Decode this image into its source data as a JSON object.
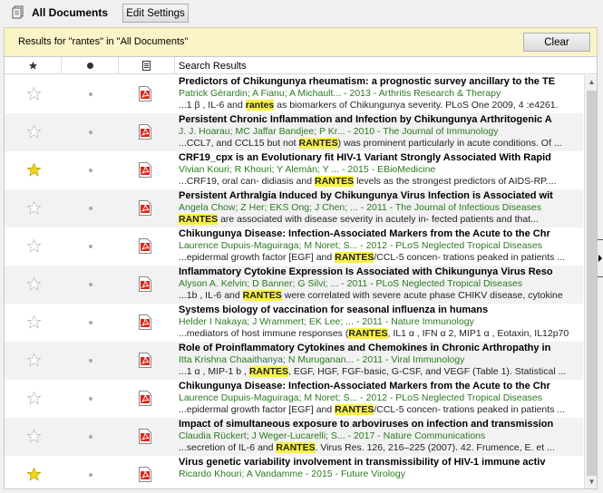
{
  "header": {
    "title": "All Documents",
    "edit_settings_label": "Edit Settings"
  },
  "search": {
    "results_label": "Results for \"rantes\" in \"All Documents\"",
    "clear_label": "Clear"
  },
  "table": {
    "columns": {
      "starred_icon": "star-icon",
      "read_icon": "dot-icon",
      "file_icon": "document-icon",
      "results_label": "Search Results"
    }
  },
  "colors": {
    "highlight": "#f7f148",
    "author": "#2a7a1f",
    "star_gold": "#f2d61c",
    "pdf_red": "#d8271c"
  },
  "results": [
    {
      "starred": false,
      "title": "Predictors of Chikungunya rheumatism: a prognostic survey ancillary to the TE",
      "authors": "Patrick Gérardin; A Fianu; A Michault... - 2013 - Arthritis Research & Therapy",
      "snippet_pre": "...1 β , IL-6 and ",
      "snippet_hl": "rantes",
      "snippet_post": " as biomarkers of Chikungunya severity. PLoS One 2009, 4 :e4261."
    },
    {
      "starred": false,
      "title": "Persistent Chronic Inflammation and Infection by Chikungunya Arthritogenic A",
      "authors": "J. J. Hoarau; MC Jaffar Bandjee; P Kr... - 2010 - The Journal of Immunology",
      "snippet_pre": "...CCL7, and CCL15 but not ",
      "snippet_hl": "RANTES",
      "snippet_post": ") was prominent particularly in acute conditions. Of ..."
    },
    {
      "starred": true,
      "title": "CRF19_cpx is an Evolutionary fit HIV-1 Variant Strongly Associated With Rapid",
      "authors": "Vivian Kouri; R Khouri; Y Alemán; Y ... - 2015 - EBioMedicine",
      "snippet_pre": "...CRF19, oral can- didiasis and ",
      "snippet_hl": "RANTES",
      "snippet_post": " levels as the strongest predictors of AIDS-RP...."
    },
    {
      "starred": false,
      "title": "Persistent Arthralgia Induced by Chikungunya Virus Infection is Associated wit",
      "authors": "Angela Chow; Z Her; EKS Ong; J Chen; ... - 2011 - The Journal of Infectious Diseases",
      "snippet_pre": "",
      "snippet_hl": "RANTES",
      "snippet_post": " are associated with disease severity in acutely in- fected patients and that..."
    },
    {
      "starred": false,
      "title": "Chikungunya Disease: Infection-Associated Markers from the Acute to the Chr",
      "authors": "Laurence Dupuis-Maguiraga; M Noret; S... - 2012 - PLoS Neglected Tropical Diseases",
      "snippet_pre": "...epidermal growth factor [EGF] and ",
      "snippet_hl": "RANTES",
      "snippet_post": "/CCL-5 concen- trations peaked in patients ..."
    },
    {
      "starred": false,
      "title": "Inflammatory Cytokine Expression Is Associated with Chikungunya Virus Reso",
      "authors": "Alyson A. Kelvin; D Banner; G Silvi; ... - 2011 - PLoS Neglected Tropical Diseases",
      "snippet_pre": "...1b , IL-6 and ",
      "snippet_hl": "RANTES",
      "snippet_post": " were correlated with severe acute phase CHIKV disease, cytokine"
    },
    {
      "starred": false,
      "title": "Systems biology of vaccination for seasonal influenza in humans",
      "authors": "Helder I Nakaya; J Wrammert; EK Lee; ... - 2011 - Nature Immunology",
      "snippet_pre": "...mediators of host immune responses (",
      "snippet_hl": "RANTES",
      "snippet_post": ", IL1 α , IFN α 2, MIP1 α , Eotaxin, IL12p70"
    },
    {
      "starred": false,
      "title": "Role of Proinflammatory Cytokines and Chemokines in Chronic Arthropathy in",
      "authors": "Itta Krishna Chaaithanya; N Muruganan... - 2011 - Viral Immunology",
      "snippet_pre": "...1 α , MIP-1 b , ",
      "snippet_hl": "RANTES",
      "snippet_post": ", EGF, HGF, FGF-basic, G-CSF, and VEGF (Table 1). Statistical ..."
    },
    {
      "starred": false,
      "title": "Chikungunya Disease: Infection-Associated Markers from the Acute to the Chr",
      "authors": "Laurence Dupuis-Maguiraga; M Noret; S... - 2012 - PLoS Neglected Tropical Diseases",
      "snippet_pre": "...epidermal growth factor [EGF] and ",
      "snippet_hl": "RANTES",
      "snippet_post": "/CCL-5 concen- trations peaked in patients ..."
    },
    {
      "starred": false,
      "title": "Impact of simultaneous exposure to arboviruses on infection and transmission",
      "authors": "Claudia Rückert; J Weger-Lucarelli; S... - 2017 - Nature Communications",
      "snippet_pre": "...secretion of IL-6 and ",
      "snippet_hl": "RANTES",
      "snippet_post": ". Virus Res. 126, 216–225 (2007). 42. Frumence, E. et ..."
    },
    {
      "starred": true,
      "title": "Virus genetic variability involvement in transmissibility of HIV-1 immune activ",
      "authors": "Ricardo Khouri; A Vandamme - 2015 - Future Virology",
      "snippet_pre": "",
      "snippet_hl": "",
      "snippet_post": ""
    }
  ]
}
